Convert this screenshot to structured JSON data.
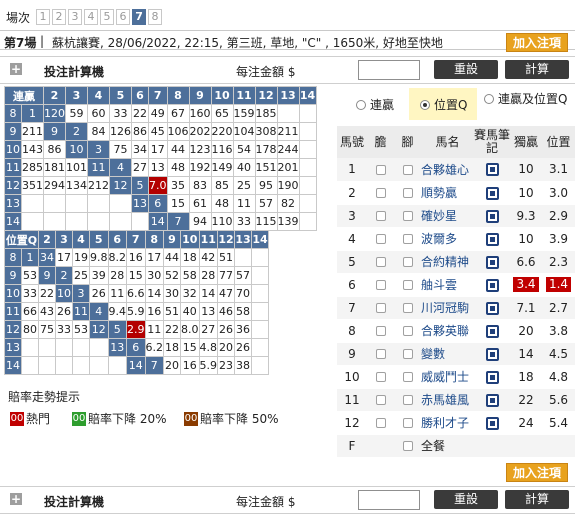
{
  "race_tabs": {
    "label": "場次",
    "tabs": [
      "1",
      "2",
      "3",
      "4",
      "5",
      "6",
      "7",
      "8"
    ],
    "active": "7"
  },
  "race": {
    "number": "第7場",
    "separator": "|",
    "info": "蘇杭讓賽, 28/06/2022, 22:15, 第三班, 草地, \"C\" , 1650米, 好地至快地"
  },
  "add_bet_label": "加入注項",
  "calc": {
    "plus": "+",
    "title": "投注計算機",
    "amount_label": "每注金額 $",
    "reset": "重設",
    "compute": "計算"
  },
  "quinella": {
    "title": "連贏",
    "headers": [
      "2",
      "3",
      "4",
      "5",
      "6",
      "7",
      "8",
      "9",
      "10",
      "11",
      "12",
      "13",
      "14"
    ],
    "rows": [
      [
        "8",
        "1",
        "120",
        "59",
        "60",
        "33",
        "22",
        "49",
        "67",
        "160",
        "65",
        "159",
        "185"
      ],
      [
        "9",
        "211",
        "9",
        "2",
        "84",
        "126",
        "86",
        "45",
        "106",
        "202",
        "220",
        "104",
        "308",
        "211"
      ],
      [
        "10",
        "143",
        "86",
        "10",
        "3",
        "75",
        "34",
        "17",
        "44",
        "123",
        "116",
        "54",
        "178",
        "244"
      ],
      [
        "11",
        "285",
        "181",
        "101",
        "11",
        "4",
        "27",
        "13",
        "48",
        "192",
        "149",
        "40",
        "151",
        "201"
      ],
      [
        "12",
        "351",
        "294",
        "134",
        "212",
        "12",
        "5",
        "7.0",
        "35",
        "83",
        "85",
        "25",
        "95",
        "190"
      ],
      [
        "13",
        "",
        "",
        "",
        "",
        "",
        "13",
        "6",
        "15",
        "61",
        "48",
        "11",
        "57",
        "82"
      ],
      [
        "14",
        "",
        "",
        "",
        "",
        "",
        "",
        "14",
        "7",
        "94",
        "110",
        "33",
        "115",
        "139"
      ]
    ]
  },
  "place_q": {
    "title": "位置Q",
    "headers": [
      "2",
      "3",
      "4",
      "5",
      "6",
      "7",
      "8",
      "9",
      "10",
      "11",
      "12",
      "13",
      "14"
    ],
    "rows": [
      [
        "8",
        "1",
        "34",
        "17",
        "19",
        "9.8",
        "8.2",
        "16",
        "17",
        "44",
        "18",
        "42",
        "51"
      ],
      [
        "9",
        "53",
        "9",
        "2",
        "25",
        "39",
        "28",
        "15",
        "30",
        "52",
        "58",
        "28",
        "77",
        "57"
      ],
      [
        "10",
        "33",
        "22",
        "10",
        "3",
        "26",
        "11",
        "6.6",
        "14",
        "30",
        "32",
        "14",
        "47",
        "70"
      ],
      [
        "11",
        "66",
        "43",
        "26",
        "11",
        "4",
        "9.4",
        "5.9",
        "16",
        "51",
        "40",
        "13",
        "46",
        "58"
      ],
      [
        "12",
        "80",
        "75",
        "33",
        "53",
        "12",
        "5",
        "2.9",
        "11",
        "22",
        "8.0",
        "27",
        "26",
        "36"
      ],
      [
        "13",
        "",
        "",
        "",
        "",
        "",
        "13",
        "6",
        "6.2",
        "18",
        "15",
        "4.8",
        "20",
        "26"
      ],
      [
        "14",
        "",
        "",
        "",
        "",
        "",
        "",
        "14",
        "7",
        "20",
        "16",
        "5.9",
        "23",
        "38"
      ]
    ],
    "right_labels": [
      "1",
      "2",
      "3",
      "4",
      "5",
      "6",
      "7"
    ]
  },
  "legend": {
    "title": "賠率走勢提示",
    "items": [
      {
        "swatch": "00",
        "label": "熱門",
        "color": "#c00000"
      },
      {
        "swatch": "00",
        "label": "賠率下降 20%",
        "color": "#2e9e2e"
      },
      {
        "swatch": "00",
        "label": "賠率下降 50%",
        "color": "#8a3b00"
      }
    ]
  },
  "pools": {
    "options": [
      "連贏",
      "位置Q",
      "連贏及位置Q"
    ],
    "selected": "位置Q"
  },
  "runners": {
    "headers": [
      "馬號",
      "膽",
      "腳",
      "馬名",
      "賽馬筆記",
      "獨贏",
      "位置"
    ],
    "rows": [
      {
        "no": "1",
        "name": "合夥雄心",
        "win": "10",
        "place": "3.1",
        "hot": false
      },
      {
        "no": "2",
        "name": "順勢贏",
        "win": "10",
        "place": "3.0",
        "hot": false
      },
      {
        "no": "3",
        "name": "確妙星",
        "win": "9.3",
        "place": "2.9",
        "hot": false
      },
      {
        "no": "4",
        "name": "波爾多",
        "win": "10",
        "place": "3.9",
        "hot": false
      },
      {
        "no": "5",
        "name": "合約精神",
        "win": "6.6",
        "place": "2.3",
        "hot": false
      },
      {
        "no": "6",
        "name": "舳斗雲",
        "win": "3.4",
        "place": "1.4",
        "hot": true
      },
      {
        "no": "7",
        "name": "川河冠駒",
        "win": "7.1",
        "place": "2.7",
        "hot": false
      },
      {
        "no": "8",
        "name": "合夥英聯",
        "win": "20",
        "place": "3.8",
        "hot": false
      },
      {
        "no": "9",
        "name": "變數",
        "win": "14",
        "place": "4.5",
        "hot": false
      },
      {
        "no": "10",
        "name": "威威鬥士",
        "win": "18",
        "place": "4.8",
        "hot": false
      },
      {
        "no": "11",
        "name": "赤馬雄風",
        "win": "22",
        "place": "5.6",
        "hot": false
      },
      {
        "no": "12",
        "name": "勝利才子",
        "win": "24",
        "place": "5.4",
        "hot": false
      }
    ],
    "field_label": "F",
    "all_label": "全餐"
  },
  "colors": {
    "header_blue": "#4d6f9a",
    "hot_red": "#b30000",
    "add_orange": "#e8a21e"
  }
}
